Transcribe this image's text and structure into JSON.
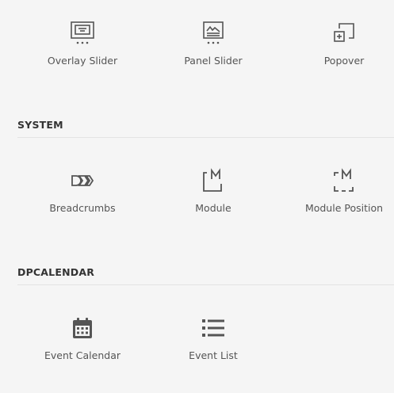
{
  "top_row": {
    "items": [
      {
        "label": "Overlay Slider",
        "icon": "overlay-slider-icon"
      },
      {
        "label": "Panel Slider",
        "icon": "panel-slider-icon"
      },
      {
        "label": "Popover",
        "icon": "popover-icon"
      }
    ]
  },
  "system": {
    "title": "SYSTEM",
    "items": [
      {
        "label": "Breadcrumbs",
        "icon": "breadcrumbs-icon"
      },
      {
        "label": "Module",
        "icon": "module-icon"
      },
      {
        "label": "Module Position",
        "icon": "module-position-icon"
      }
    ]
  },
  "dpcalendar": {
    "title": "DPCALENDAR",
    "items": [
      {
        "label": "Event Calendar",
        "icon": "calendar-icon"
      },
      {
        "label": "Event List",
        "icon": "list-icon"
      }
    ]
  },
  "colors": {
    "background": "#f5f5f5",
    "icon": "#555555",
    "heading": "#333333",
    "divider": "#e3e3e3"
  }
}
